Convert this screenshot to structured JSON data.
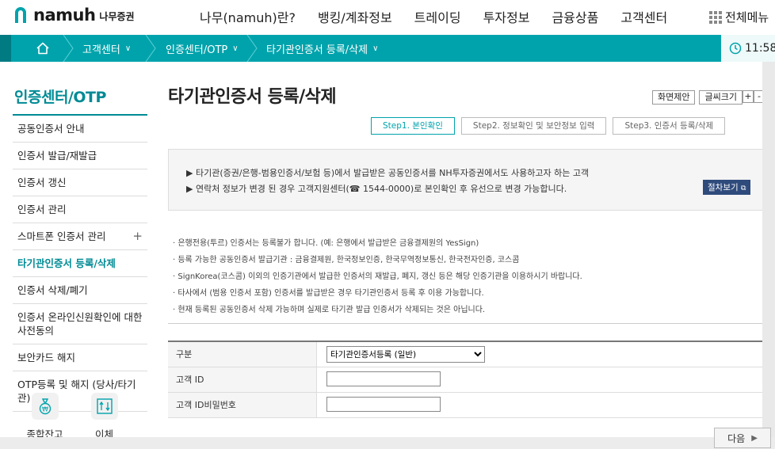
{
  "brand": {
    "name": "namuh",
    "sub": "나무증권"
  },
  "gnb": [
    "나무(namuh)란?",
    "뱅킹/계좌정보",
    "트레이딩",
    "투자정보",
    "금융상품",
    "고객센터"
  ],
  "allmenu_label": "전체메뉴",
  "breadcrumb": [
    "고객센터",
    "인증센터/OTP",
    "타기관인증서 등록/삭제"
  ],
  "clock_text": "11:58",
  "lnb": {
    "title": "인증센터/OTP",
    "items": [
      "공동인증서 안내",
      "인증서 발급/재발급",
      "인증서 갱신",
      "인증서 관리",
      "스마트폰 인증서 관리",
      "타기관인증서 등록/삭제",
      "인증서 삭제/폐기",
      "인증서 온라인신원확인에 대한 사전동의",
      "보안카드 해지",
      "OTP등록 및 해지 (당사/타기관)"
    ],
    "active_index": 5
  },
  "quick": [
    "종합잔고",
    "이체"
  ],
  "page_title": "타기관인증서 등록/삭제",
  "tools": {
    "suggest": "화면제안",
    "fontsize": "글씨크기",
    "plus": "+",
    "minus": "-"
  },
  "steps": [
    "Step1. 본인확인",
    "Step2. 정보확인 및 보안정보 입력",
    "Step3. 인증서 등록/삭제"
  ],
  "info": {
    "line1": "▶ 타기관(증권/은행-범용인증서/보험 등)에서 발급받은 공동인증서를 NH투자증권에서도 사용하고자 하는 고객",
    "line2": "▶ 연락처 정보가 변경 된 경우 고객지원센터(☎ 1544-0000)로 본인확인 후 유선으로 변경 가능합니다.",
    "proc_button": "절차보기"
  },
  "notes": [
    "· 은행전용(투르) 인증서는 등록불가 합니다. (예: 은행에서 발급받은 금융결제원의 YesSign)",
    "· 등록 가능한 공동인증서 발급기관 : 금융결제원, 한국정보인증, 한국무역정보통신, 한국전자인증, 코스콤",
    "· SignKorea(코스콤) 이외의 인증기관에서 발급한 인증서의 재발급, 폐지, 갱신 등은 해당 인증기관을 이용하시기 바랍니다.",
    "· 타사에서 (범용 인증서 포함) 인증서를 발급받은 경우 타기관인증서 등록 후 이용 가능합니다.",
    "· 현재 등록된 공동인증서 삭제 가능하며 실제로 타기관 발급 인증서가 삭제되는 것은 아닙니다."
  ],
  "form": {
    "type_label": "구분",
    "type_value": "타기관인증서등록 (일반)",
    "id_label": "고객 ID",
    "id_value": "",
    "pw_label": "고객 ID비밀번호",
    "pw_value": ""
  },
  "next_button": "다음"
}
